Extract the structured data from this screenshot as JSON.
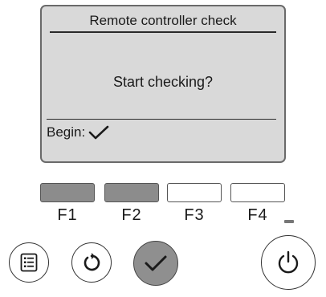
{
  "screen": {
    "title": "Remote controller check",
    "message": "Start checking?",
    "footer_label": "Begin:",
    "footer_icon": "check-icon"
  },
  "function_keys": [
    {
      "label": "F1",
      "state": "active"
    },
    {
      "label": "F2",
      "state": "active"
    },
    {
      "label": "F3",
      "state": "inactive"
    },
    {
      "label": "F4",
      "state": "inactive"
    }
  ],
  "buttons": {
    "menu": {
      "icon": "menu-icon"
    },
    "return": {
      "icon": "return-icon"
    },
    "enter": {
      "icon": "check-icon"
    },
    "power": {
      "icon": "power-icon"
    }
  },
  "colors": {
    "lcd_background": "#d9d9d9",
    "key_active": "#8c8c8c",
    "enter_button": "#8f8f8f"
  }
}
